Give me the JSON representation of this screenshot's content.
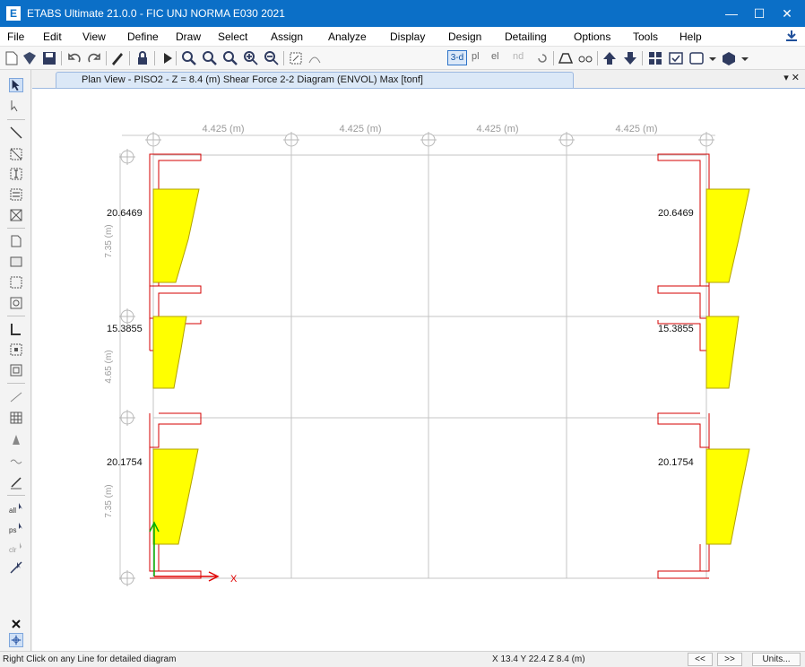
{
  "window": {
    "title": "ETABS Ultimate 21.0.0 - FIC UNJ NORMA E030 2021",
    "app_icon": "E",
    "minimize_glyph": "—",
    "maximize_glyph": "☐",
    "close_glyph": "✕"
  },
  "menu": [
    "File",
    "Edit",
    "View",
    "Define",
    "Draw",
    "Select",
    "Assign",
    "Analyze",
    "Display",
    "Design",
    "Detailing",
    "Options",
    "Tools",
    "Help"
  ],
  "toolbar": {
    "view_3d": "3-d",
    "plan": "pl",
    "elev": "el",
    "nd": "nd"
  },
  "tab": {
    "title": "Plan View - PISO2 - Z = 8.4 (m)    Shear Force 2-2 Diagram    (ENVOL) Max  [tonf]",
    "controls": "▾ ✕"
  },
  "plan": {
    "bay_dims": [
      "4.425 (m)",
      "4.425 (m)",
      "4.425 (m)",
      "4.425 (m)"
    ],
    "span_dims": [
      "7.35 (m)",
      "4.65 (m)",
      "7.35 (m)"
    ],
    "left_shear_values": [
      "20.6469",
      "15.3855",
      "20.1754"
    ],
    "right_shear_values": [
      "20.6469",
      "15.3855",
      "20.1754"
    ],
    "axis_label": "X",
    "diagram_fill": "#ffff00",
    "member_color": "#d40000"
  },
  "status": {
    "hint": "Right Click on any Line for detailed diagram",
    "coords": "X 13.4  Y 22.4  Z 8.4 (m)",
    "prev": "<<",
    "next": ">>",
    "units": "Units..."
  },
  "colors": {
    "title_bar": "#0b6fc7",
    "grid": "#c0c0c0",
    "diagram_fill": "#ffff00",
    "members": "#d40000"
  }
}
